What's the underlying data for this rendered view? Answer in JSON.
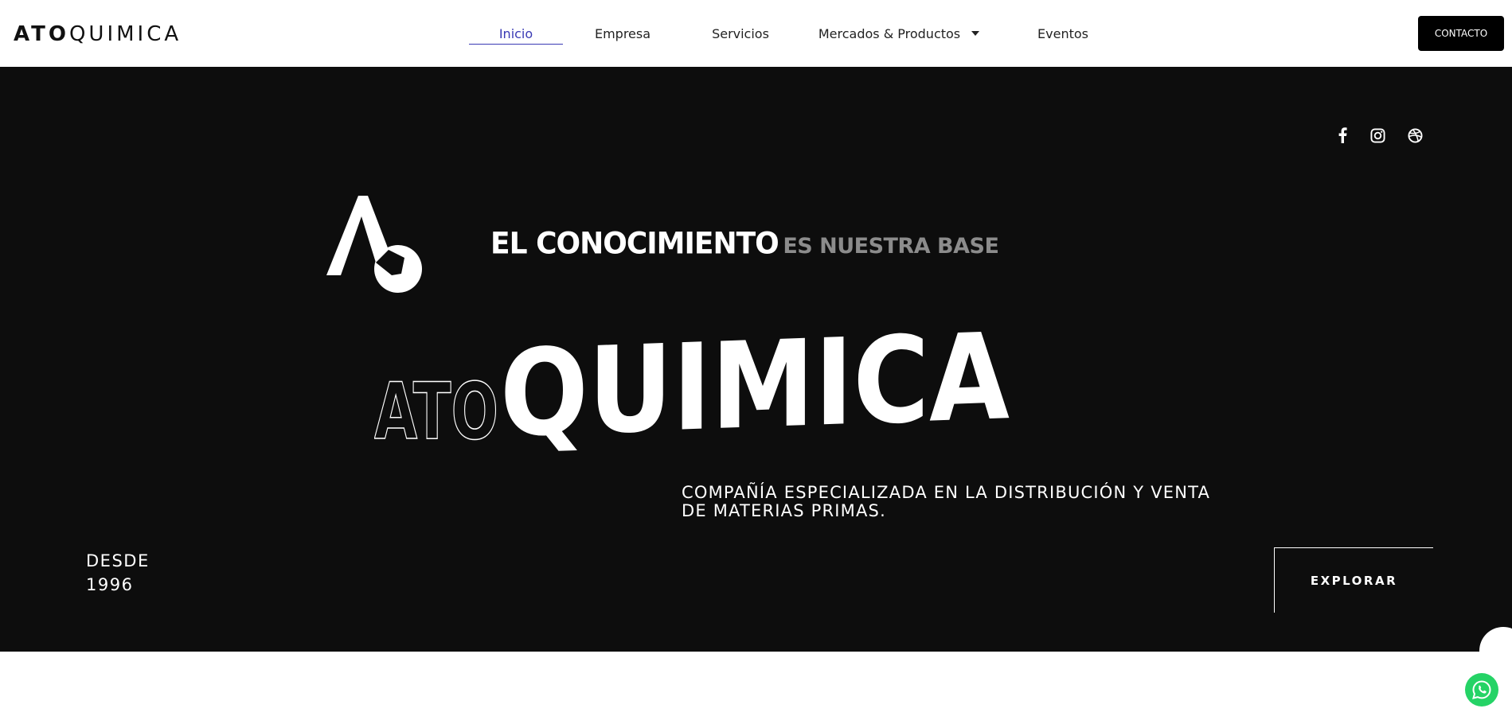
{
  "header": {
    "logo": {
      "bold": "ATO",
      "light": "QUIMICA"
    },
    "nav": [
      {
        "label": "Inicio",
        "active": true
      },
      {
        "label": "Empresa",
        "active": false
      },
      {
        "label": "Servicios",
        "active": false
      },
      {
        "label": "Mercados & Productos",
        "active": false,
        "dropdown": true
      },
      {
        "label": "Eventos",
        "active": false
      }
    ],
    "contact_label": "CONTACTO"
  },
  "hero": {
    "social_icons": [
      "facebook-icon",
      "instagram-icon",
      "dribbble-icon"
    ],
    "tagline_white": "EL CONOCIMIENTO",
    "tagline_gray": "ES NUESTRA BASE",
    "title_outline": "ATO",
    "title_solid": "QUIMICA",
    "subtitle": "COMPAÑÍA ESPECIALIZADA EN LA DISTRIBUCIÓN Y VENTA DE MATERIAS PRIMAS.",
    "since_line1": "DESDE",
    "since_line2": "1996",
    "explore_label": "EXPLORAR"
  },
  "colors": {
    "hero_bg": "#0d0d0d",
    "nav_active": "#3a3ab4",
    "tagline_gray": "#8c8c8c",
    "whatsapp": "#25d366"
  }
}
